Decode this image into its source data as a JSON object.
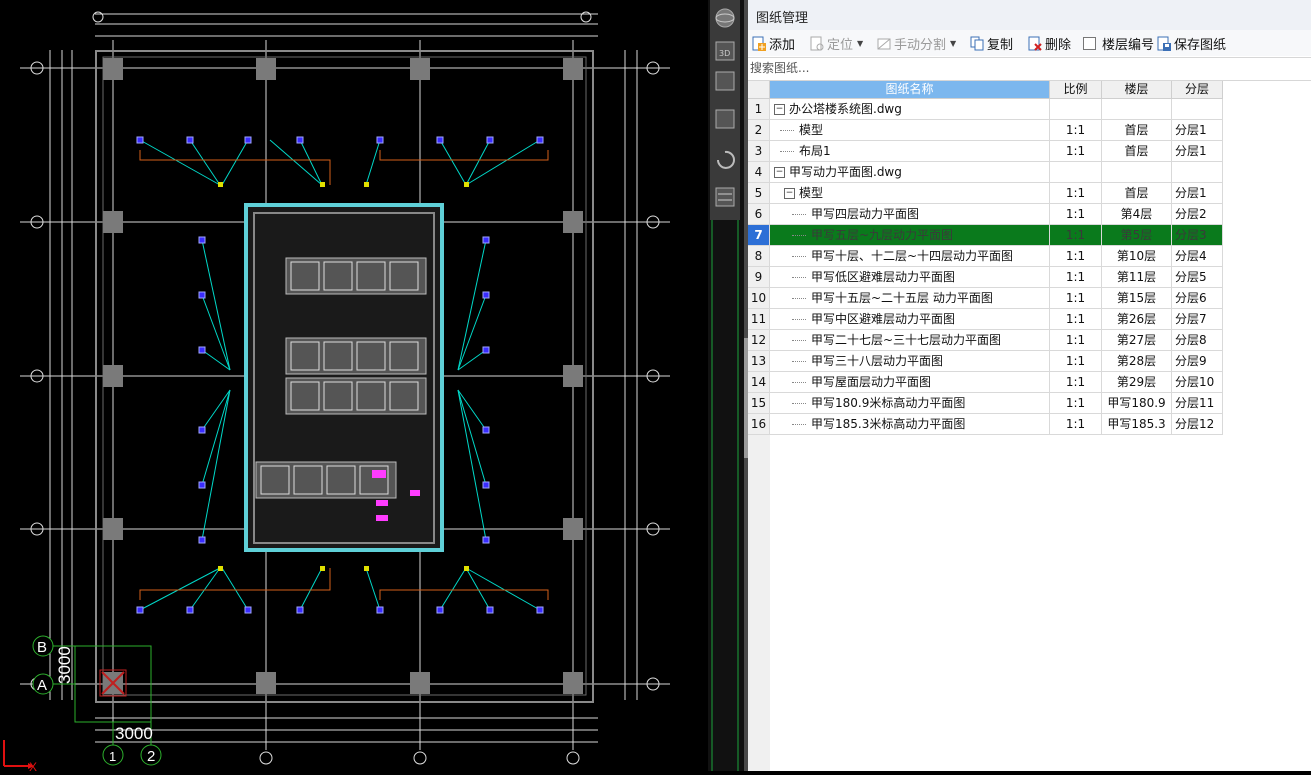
{
  "panel": {
    "title": "图纸管理",
    "toolbar": {
      "add": "添加",
      "locate": "定位",
      "manual_split": "手动分割",
      "copy": "复制",
      "delete": "删除",
      "floor_number": "楼层编号",
      "save": "保存图纸"
    },
    "search_placeholder": "搜索图纸...",
    "columns": {
      "name": "图纸名称",
      "scale": "比例",
      "floor": "楼层",
      "layer": "分层"
    },
    "rows": [
      {
        "n": "1",
        "name": "办公塔楼系统图.dwg",
        "scale": "",
        "floor": "",
        "layer": ""
      },
      {
        "n": "2",
        "name": "模型",
        "scale": "1:1",
        "floor": "首层",
        "layer": "分层1"
      },
      {
        "n": "3",
        "name": "布局1",
        "scale": "1:1",
        "floor": "首层",
        "layer": "分层1"
      },
      {
        "n": "4",
        "name": "甲写动力平面图.dwg",
        "scale": "",
        "floor": "",
        "layer": ""
      },
      {
        "n": "5",
        "name": "模型",
        "scale": "1:1",
        "floor": "首层",
        "layer": "分层1"
      },
      {
        "n": "6",
        "name": "甲写四层动力平面图",
        "scale": "1:1",
        "floor": "第4层",
        "layer": "分层2"
      },
      {
        "n": "7",
        "name": "甲写五层~九层动力平面图",
        "scale": "1:1",
        "floor": "第5层",
        "layer": "分层3"
      },
      {
        "n": "8",
        "name": "甲写十层、十二层~十四层动力平面图",
        "scale": "1:1",
        "floor": "第10层",
        "layer": "分层4"
      },
      {
        "n": "9",
        "name": "甲写低区避难层动力平面图",
        "scale": "1:1",
        "floor": "第11层",
        "layer": "分层5"
      },
      {
        "n": "10",
        "name": "甲写十五层~二十五层 动力平面图",
        "scale": "1:1",
        "floor": "第15层",
        "layer": "分层6"
      },
      {
        "n": "11",
        "name": "甲写中区避难层动力平面图",
        "scale": "1:1",
        "floor": "第26层",
        "layer": "分层7"
      },
      {
        "n": "12",
        "name": "甲写二十七层~三十七层动力平面图",
        "scale": "1:1",
        "floor": "第27层",
        "layer": "分层8"
      },
      {
        "n": "13",
        "name": "甲写三十八层动力平面图",
        "scale": "1:1",
        "floor": "第28层",
        "layer": "分层9"
      },
      {
        "n": "14",
        "name": "甲写屋面层动力平面图",
        "scale": "1:1",
        "floor": "第29层",
        "layer": "分层10"
      },
      {
        "n": "15",
        "name": "甲写180.9米标高动力平面图",
        "scale": "1:1",
        "floor": "甲写180.9",
        "layer": "分层11"
      },
      {
        "n": "16",
        "name": "甲写185.3米标高动力平面图",
        "scale": "1:1",
        "floor": "甲写185.3",
        "layer": "分层12"
      }
    ]
  },
  "cad": {
    "dims": {
      "grid_size_v": "3000",
      "grid_size_h": "3000"
    },
    "axis_labels": {
      "b": "B",
      "a": "A",
      "one": "1",
      "two": "2",
      "x": "X"
    }
  },
  "colors": {
    "accent": "#7cb7ee",
    "selected_row": "#0a7a1c",
    "cad_wall": "#5fd0d8",
    "cad_wire": "#00d8c8",
    "cad_orange": "#d4601a"
  }
}
